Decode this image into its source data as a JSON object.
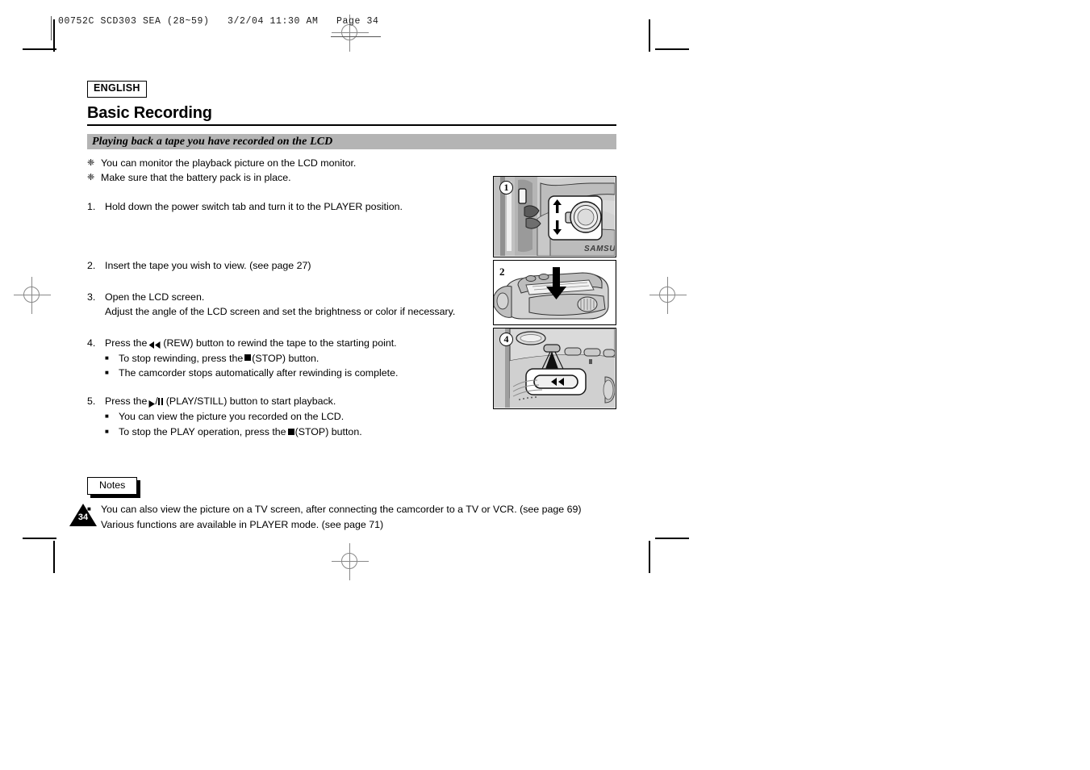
{
  "printer_marks": {
    "slugline": "00752C SCD303 SEA (28~59)   3/2/04 11:30 AM   Page 34"
  },
  "page": {
    "language_badge": "ENGLISH",
    "chapter_title": "Basic Recording",
    "section_title": "Playing back a tape you have recorded on the LCD",
    "page_number": "34",
    "intro_bullets": [
      {
        "glyph": "❈",
        "text": "You can monitor the playback picture on the LCD monitor."
      },
      {
        "glyph": "❈",
        "text": "Make sure that the battery pack is in place."
      }
    ],
    "steps": [
      {
        "num": "1.",
        "text": "Hold down the power switch tab and turn it to the PLAYER position.",
        "subitems": []
      },
      {
        "num": "2.",
        "text": "Insert the tape you wish to view. (see page 27)",
        "subitems": []
      },
      {
        "num": "3.",
        "text": "Open the LCD screen.",
        "text2": "Adjust the angle of the LCD screen and set the brightness or color if necessary.",
        "subitems": []
      },
      {
        "num": "4.",
        "text_before": "Press the",
        "icon": "rewind-icon",
        "text_after": "(REW) button to rewind the tape to the starting point.",
        "subitems": [
          {
            "glyph": "■",
            "text_before": "To stop rewinding, press the",
            "icon": "stop-icon",
            "text_after": "(STOP) button."
          },
          {
            "glyph": "■",
            "text_before": "The camcorder stops automatically after rewinding is complete.",
            "icon": "",
            "text_after": ""
          }
        ]
      },
      {
        "num": "5.",
        "text_before": "Press the",
        "icon": "play-still-icon",
        "text_after": "(PLAY/STILL) button to start playback.",
        "subitems": [
          {
            "glyph": "■",
            "text_before": "You can view the picture you recorded on the LCD.",
            "icon": "",
            "text_after": ""
          },
          {
            "glyph": "■",
            "text_before": "To stop the PLAY operation, press the",
            "icon": "stop-icon",
            "text_after": "(STOP) button."
          }
        ]
      }
    ],
    "notes": {
      "label": "Notes",
      "items": [
        {
          "glyph": "■",
          "text": "You can also view the picture on a TV screen, after connecting the camcorder to a TV or VCR. (see page 69)"
        },
        {
          "glyph": "■",
          "text": "Various functions are available in PLAYER mode. (see page 71)"
        }
      ]
    }
  },
  "figures": [
    {
      "number": "1",
      "caption": "camcorder power switch with up and down arrows and mode dial",
      "brand_text": "SAMSUNG"
    },
    {
      "number": "2",
      "caption": "camcorder tape compartment open with downward insertion arrow"
    },
    {
      "number": "4",
      "caption": "close-up callout of the REW button on the camcorder",
      "button_icon": "rewind-icon"
    }
  ],
  "colors": {
    "section_bar_gray": "#b4b4b4",
    "figure_background": "#e8e8e8",
    "ink_black": "#000000",
    "registration_gray": "#888888"
  }
}
